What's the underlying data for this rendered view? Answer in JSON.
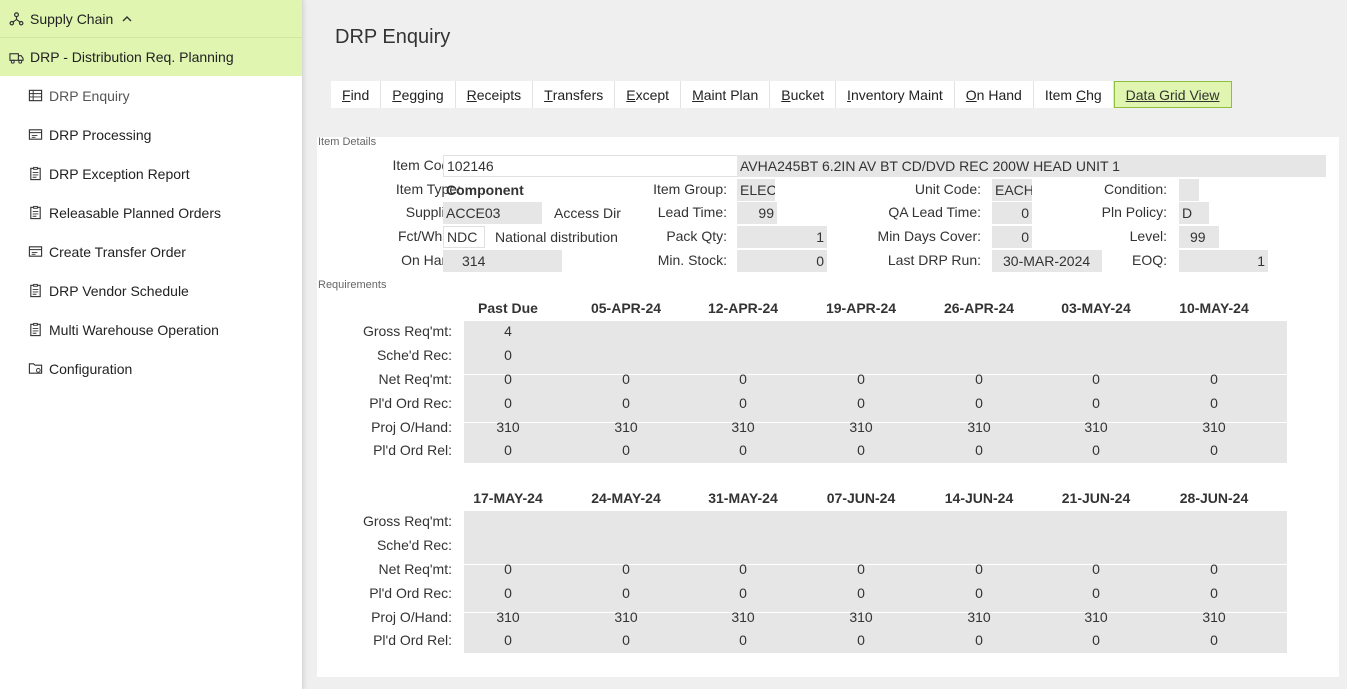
{
  "sidebar": {
    "top": {
      "label": "Supply Chain",
      "icon": "network-icon"
    },
    "module": {
      "label": "DRP - Distribution Req. Planning",
      "icon": "truck-icon"
    },
    "items": [
      {
        "label": "DRP Enquiry",
        "icon": "table-icon"
      },
      {
        "label": "DRP Processing",
        "icon": "card-icon"
      },
      {
        "label": "DRP Exception Report",
        "icon": "clipboard-icon"
      },
      {
        "label": "Releasable Planned Orders",
        "icon": "clipboard-icon"
      },
      {
        "label": "Create Transfer Order",
        "icon": "card-icon"
      },
      {
        "label": "DRP Vendor Schedule",
        "icon": "clipboard-icon"
      },
      {
        "label": "Multi Warehouse Operation",
        "icon": "clipboard-icon"
      },
      {
        "label": "Configuration",
        "icon": "folder-gear-icon"
      }
    ]
  },
  "page": {
    "title": "DRP Enquiry"
  },
  "tabs": [
    {
      "u": "F",
      "rest": "ind"
    },
    {
      "u": "P",
      "rest": "egging"
    },
    {
      "u": "R",
      "rest": "eceipts"
    },
    {
      "u": "T",
      "rest": "ransfers"
    },
    {
      "u": "E",
      "rest": "xcept"
    },
    {
      "u": "M",
      "rest": "aint Plan"
    },
    {
      "u": "B",
      "rest": "ucket"
    },
    {
      "u": "I",
      "rest": "nventory Maint"
    },
    {
      "u": "O",
      "rest": "n Hand"
    },
    {
      "pre": "Item ",
      "u": "C",
      "rest": "hg"
    },
    {
      "u": "D",
      "rest": "ata Grid View"
    }
  ],
  "item_details": {
    "section_label": "Item Details",
    "item_code_label": "Item Code:",
    "item_code": "102146",
    "description": "AVHA245BT 6.2IN AV BT CD/DVD REC 200W HEAD UNIT 1",
    "item_type_label": "Item Type:",
    "item_type": "Component",
    "item_group_label": "Item Group:",
    "item_group": "ELEC",
    "unit_code_label": "Unit Code:",
    "unit_code": "EACH",
    "condition_label": "Condition:",
    "condition": "",
    "supplier_label": "Supplier:",
    "supplier": "ACCE03",
    "supplier_name": "Access Dir",
    "lead_time_label": "Lead Time:",
    "lead_time": "99",
    "qa_lead_time_label": "QA Lead Time:",
    "qa_lead_time": "0",
    "pln_policy_label": "Pln Policy:",
    "pln_policy": "D",
    "fct_whse_label": "Fct/Whse:",
    "fct_whse": "NDC",
    "whse_name": "National distribution",
    "pack_qty_label": "Pack Qty:",
    "pack_qty": "1",
    "min_days_cover_label": "Min Days Cover:",
    "min_days_cover": "0",
    "level_label": "Level:",
    "level": "99",
    "on_hand_label": "On Hand:",
    "on_hand": "314",
    "min_stock_label": "Min. Stock:",
    "min_stock": "0",
    "last_drp_run_label": "Last DRP Run:",
    "last_drp_run": "30-MAR-2024",
    "eoq_label": "EOQ:",
    "eoq": "1"
  },
  "requirements": {
    "section_label": "Requirements",
    "row_labels": [
      "Gross Req'mt:",
      "Sche'd Rec:",
      "Net Req'mt:",
      "Pl'd Ord Rec:",
      "Proj O/Hand:",
      "Pl'd Ord Rel:"
    ],
    "blocks": [
      {
        "headers": [
          "Past Due",
          "05-APR-24",
          "12-APR-24",
          "19-APR-24",
          "26-APR-24",
          "03-MAY-24",
          "10-MAY-24"
        ],
        "rows": [
          [
            "4",
            "",
            "",
            "",
            "",
            "",
            ""
          ],
          [
            "0",
            "",
            "",
            "",
            "",
            "",
            ""
          ],
          [
            "0",
            "0",
            "0",
            "0",
            "0",
            "0",
            "0"
          ],
          [
            "0",
            "0",
            "0",
            "0",
            "0",
            "0",
            "0"
          ],
          [
            "310",
            "310",
            "310",
            "310",
            "310",
            "310",
            "310"
          ],
          [
            "0",
            "0",
            "0",
            "0",
            "0",
            "0",
            "0"
          ]
        ]
      },
      {
        "headers": [
          "17-MAY-24",
          "24-MAY-24",
          "31-MAY-24",
          "07-JUN-24",
          "14-JUN-24",
          "21-JUN-24",
          "28-JUN-24"
        ],
        "rows": [
          [
            "",
            "",
            "",
            "",
            "",
            "",
            ""
          ],
          [
            "",
            "",
            "",
            "",
            "",
            "",
            ""
          ],
          [
            "0",
            "0",
            "0",
            "0",
            "0",
            "0",
            "0"
          ],
          [
            "0",
            "0",
            "0",
            "0",
            "0",
            "0",
            "0"
          ],
          [
            "310",
            "310",
            "310",
            "310",
            "310",
            "310",
            "310"
          ],
          [
            "0",
            "0",
            "0",
            "0",
            "0",
            "0",
            "0"
          ]
        ]
      }
    ]
  },
  "colors": {
    "accent": "#dff5b0",
    "accent_border": "#8fbf3f",
    "field_bg": "#e6e6e6"
  }
}
